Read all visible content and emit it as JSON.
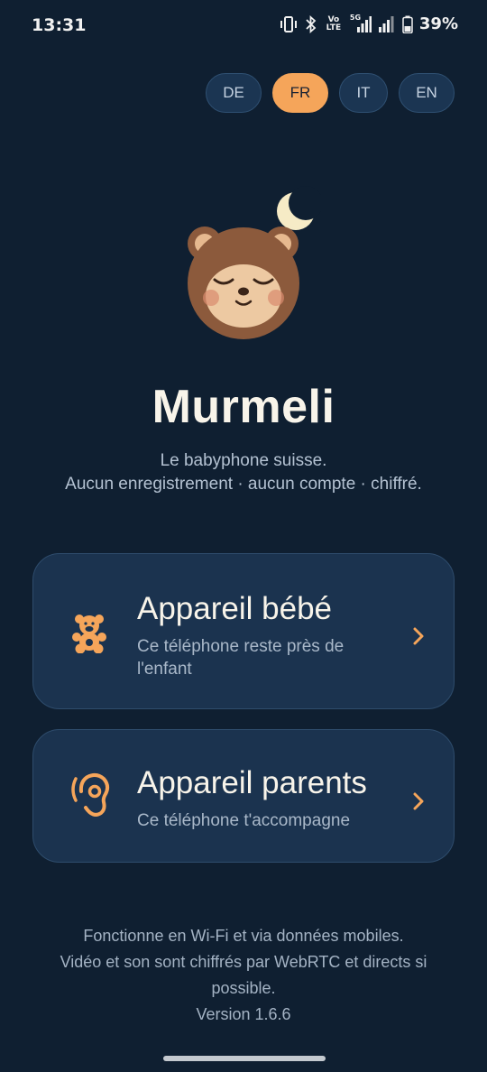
{
  "status_bar": {
    "time": "13:31",
    "volte_top": "Vo",
    "volte_bottom": "LTE",
    "network": "5G",
    "battery": "39%",
    "icons": [
      "vibrate-icon",
      "bluetooth-icon",
      "volte-icon",
      "signal-5g-icon",
      "signal-icon",
      "battery-icon"
    ]
  },
  "languages": [
    {
      "code": "DE",
      "active": false
    },
    {
      "code": "FR",
      "active": true
    },
    {
      "code": "IT",
      "active": false
    },
    {
      "code": "EN",
      "active": false
    }
  ],
  "app": {
    "title": "Murmeli",
    "tagline_line1": "Le babyphone suisse.",
    "tagline_line2": "Aucun enregistrement · aucun compte · chiffré."
  },
  "cards": {
    "baby": {
      "title": "Appareil bébé",
      "subtitle": "Ce téléphone reste près de l'enfant",
      "icon": "teddy-bear-icon"
    },
    "parents": {
      "title": "Appareil parents",
      "subtitle": "Ce téléphone t'accompagne",
      "icon": "ear-icon"
    }
  },
  "footer": {
    "line1": "Fonctionne en Wi-Fi et via données mobiles.",
    "line2": "Vidéo et son sont chiffrés par WebRTC et directs si possible.",
    "version": "Version 1.6.6"
  },
  "colors": {
    "background": "#0f1f31",
    "card": "#1b334f",
    "accent": "#f5a55a",
    "bear_brown": "#8c5a3c"
  }
}
